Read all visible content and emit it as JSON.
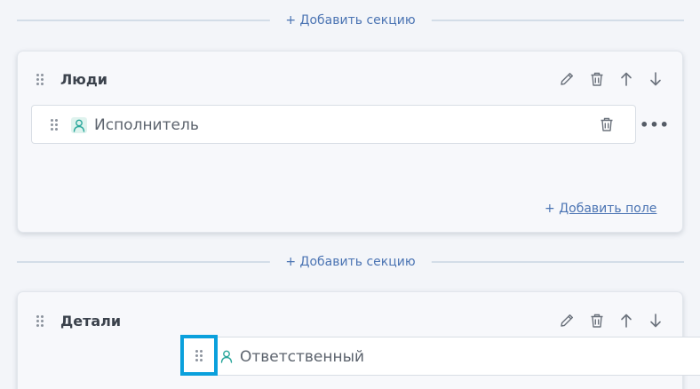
{
  "dividers": [
    {
      "add_section_label": "+ Добавить секцию"
    },
    {
      "add_section_label": "+ Добавить секцию"
    }
  ],
  "sections": [
    {
      "title": "Люди",
      "fields": [
        {
          "label": "Исполнитель",
          "icon": "user-icon"
        }
      ],
      "add_field_prefix": "+",
      "add_field_label": "Добавить поле"
    },
    {
      "title": "Детали",
      "fields": []
    }
  ],
  "dragged_field": {
    "label": "Ответственный",
    "icon": "user-icon"
  },
  "colors": {
    "accent": "#4b74b3",
    "focus_ring": "#0aa0dc",
    "user_icon": "#2aa79b",
    "page_bg": "#f3f5f9"
  }
}
